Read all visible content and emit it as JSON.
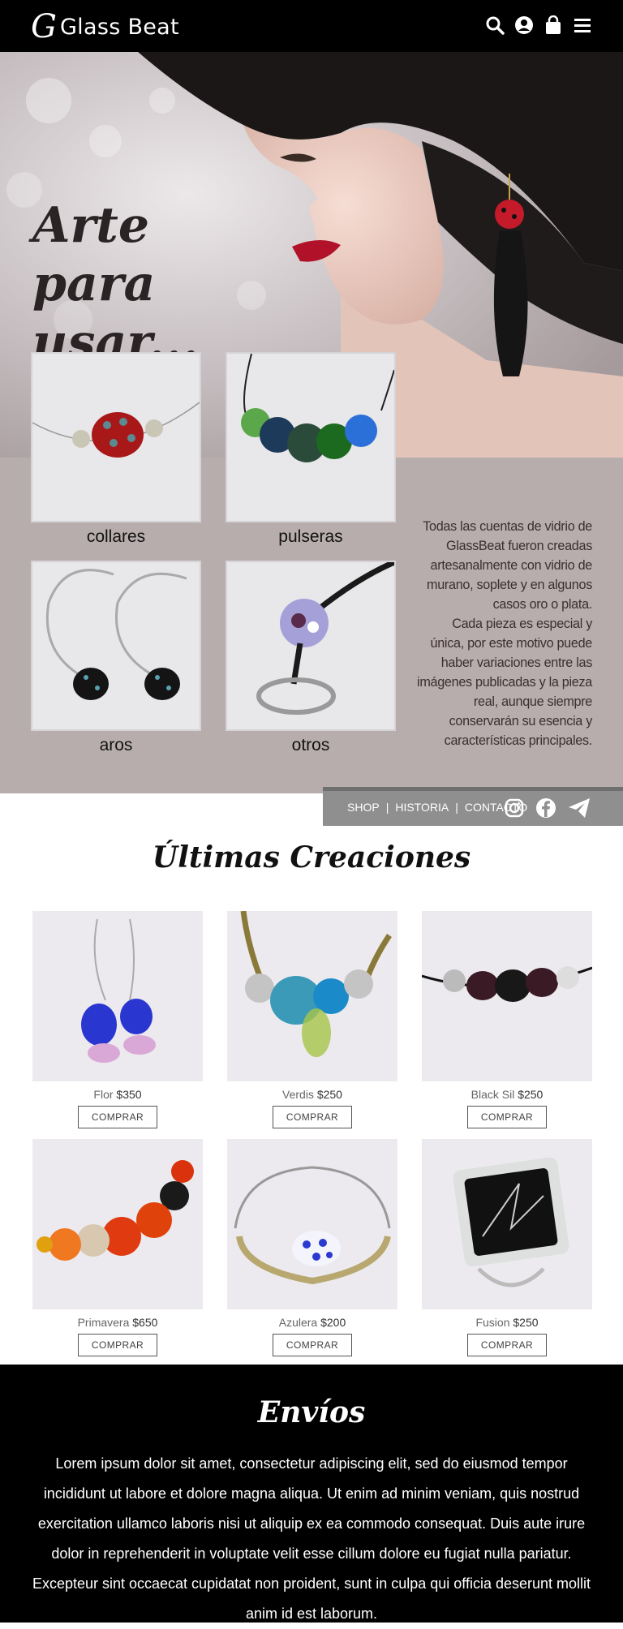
{
  "header": {
    "logo_mark": "G",
    "logo_text": "Glass Beat",
    "icons": [
      "search-icon",
      "user-icon",
      "shopping-bag-icon",
      "menu-icon"
    ]
  },
  "hero": {
    "title": "Arte\npara usar...",
    "categories": [
      {
        "label": "collares"
      },
      {
        "label": "pulseras"
      },
      {
        "label": "aros"
      },
      {
        "label": "otros"
      }
    ],
    "description": "Todas las cuentas de vidrio de GlassBeat fueron creadas artesanalmente con vidrio de murano, soplete y en algunos casos oro o plata.\nCada pieza es especial y única, por este motivo puede haber variaciones entre las imágenes publicadas y la pieza real, aunque siempre conservarán su esencia y características principales."
  },
  "subnav": {
    "links": [
      "SHOP",
      "HISTORIA",
      "CONTACTO"
    ],
    "separator": "|",
    "social_icons": [
      "instagram-icon",
      "facebook-icon",
      "paper-plane-icon"
    ]
  },
  "latest": {
    "title": "Últimas Creaciones",
    "buy_label": "COMPRAR",
    "products": [
      {
        "name": "Flor",
        "price": "$350"
      },
      {
        "name": "Verdis",
        "price": "$250"
      },
      {
        "name": "Black Sil",
        "price": "$250"
      },
      {
        "name": "Primavera",
        "price": "$650"
      },
      {
        "name": "Azulera",
        "price": "$200"
      },
      {
        "name": "Fusion",
        "price": "$250"
      }
    ]
  },
  "shipping": {
    "title": "Envíos",
    "text": "Lorem ipsum dolor sit amet, consectetur adipiscing elit, sed do eiusmod tempor incididunt ut labore et dolore magna aliqua. Ut enim ad minim veniam, quis nostrud exercitation ullamco laboris nisi ut aliquip ex ea commodo consequat. Duis aute irure dolor in reprehenderit in voluptate velit esse cillum dolore eu fugiat nulla pariatur. Excepteur sint occaecat cupidatat non proident, sunt in culpa qui officia deserunt mollit anim id est laborum."
  }
}
